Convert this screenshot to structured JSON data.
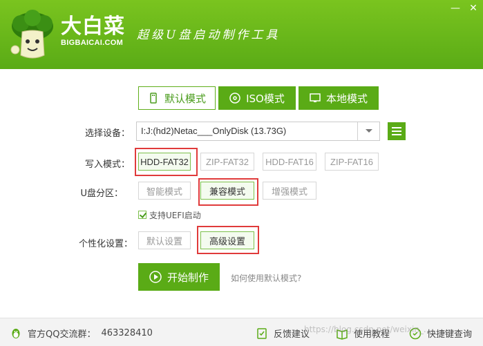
{
  "header": {
    "brand_cn": "大白菜",
    "brand_en": "BIGBAICAI.COM",
    "slogan": "超级U盘启动制作工具",
    "min_symbol": "—",
    "close_symbol": "✕",
    "bg_color": "#5aab16"
  },
  "tabs": [
    {
      "label": "默认模式",
      "icon": "usb-icon",
      "active": true
    },
    {
      "label": "ISO模式",
      "icon": "disc-icon",
      "active": false
    },
    {
      "label": "本地模式",
      "icon": "monitor-icon",
      "active": false
    }
  ],
  "device": {
    "label": "选择设备：",
    "value": "I:J:(hd2)Netac___OnlyDisk (13.73G)"
  },
  "write_mode": {
    "label": "写入模式：",
    "options": [
      "HDD-FAT32",
      "ZIP-FAT32",
      "HDD-FAT16",
      "ZIP-FAT16"
    ],
    "selected": "HDD-FAT32"
  },
  "partition": {
    "label": "U盘分区：",
    "options": [
      "智能模式",
      "兼容模式",
      "增强模式"
    ],
    "selected": "兼容模式"
  },
  "uefi": {
    "label": "支持UEFI启动",
    "checked": true
  },
  "personalize": {
    "label": "个性化设置：",
    "options": [
      "默认设置",
      "高级设置"
    ],
    "selected": "高级设置"
  },
  "start_button": "开始制作",
  "help_link": "如何使用默认模式?",
  "footer": {
    "qq_label": "官方QQ交流群：",
    "qq_number": "463328410",
    "feedback": "反馈建议",
    "tutorial": "使用教程",
    "shortcut": "快捷键查询"
  },
  "watermark": "https://blog.csdn.net/weixin_..."
}
